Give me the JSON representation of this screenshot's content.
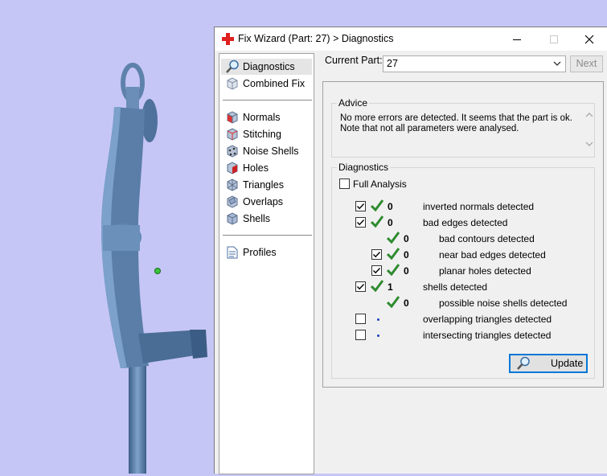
{
  "window": {
    "title": "Fix Wizard (Part: 27) > Diagnostics",
    "controls": [
      "minimize",
      "maximize",
      "close"
    ]
  },
  "nav": {
    "items": [
      {
        "label": "Diagnostics",
        "icon": "magnifier-icon",
        "selected": true
      },
      {
        "label": "Combined Fix",
        "icon": "cube-icon"
      },
      {
        "label": "Normals",
        "icon": "normals-cube-icon"
      },
      {
        "label": "Stitching",
        "icon": "stitching-cube-icon"
      },
      {
        "label": "Noise Shells",
        "icon": "noise-shells-icon"
      },
      {
        "label": "Holes",
        "icon": "holes-cube-icon"
      },
      {
        "label": "Triangles",
        "icon": "triangles-cube-icon"
      },
      {
        "label": "Overlaps",
        "icon": "overlaps-cube-icon"
      },
      {
        "label": "Shells",
        "icon": "shells-cube-icon"
      },
      {
        "label": "Profiles",
        "icon": "document-icon"
      }
    ]
  },
  "part": {
    "label": "Current Part:",
    "value": "27",
    "next_label": "Next"
  },
  "advice": {
    "title": "Advice",
    "text": "No more errors are detected. It seems that the part is ok. Note that not all parameters were analysed."
  },
  "diagnostics": {
    "title": "Diagnostics",
    "full_analysis_label": "Full Analysis",
    "full_analysis_checked": false,
    "rows": [
      {
        "checkbox": true,
        "checked": true,
        "status": "ok",
        "count": "0",
        "label": "inverted normals detected",
        "indent": 0
      },
      {
        "checkbox": true,
        "checked": true,
        "status": "ok",
        "count": "0",
        "label": "bad edges detected",
        "indent": 0
      },
      {
        "checkbox": false,
        "checked": false,
        "status": "ok",
        "count": "0",
        "label": "bad contours detected",
        "indent": 1
      },
      {
        "checkbox": true,
        "checked": true,
        "status": "ok",
        "count": "0",
        "label": "near bad edges detected",
        "indent": 1
      },
      {
        "checkbox": true,
        "checked": true,
        "status": "ok",
        "count": "0",
        "label": "planar holes detected",
        "indent": 1
      },
      {
        "checkbox": true,
        "checked": true,
        "status": "ok",
        "count": "1",
        "label": "shells detected",
        "indent": 0
      },
      {
        "checkbox": false,
        "checked": false,
        "status": "ok",
        "count": "0",
        "label": "possible noise shells detected",
        "indent": 1
      },
      {
        "checkbox": true,
        "checked": false,
        "status": "pending",
        "count": "",
        "label": "overlapping triangles detected",
        "indent": 0
      },
      {
        "checkbox": true,
        "checked": false,
        "status": "pending",
        "count": "",
        "label": "intersecting triangles detected",
        "indent": 0
      }
    ],
    "update_label": "Update"
  },
  "colors": {
    "background": "#c6c6f6",
    "model": "#5e82ab",
    "check": "#2e8b2e",
    "accent": "#0078d7"
  }
}
